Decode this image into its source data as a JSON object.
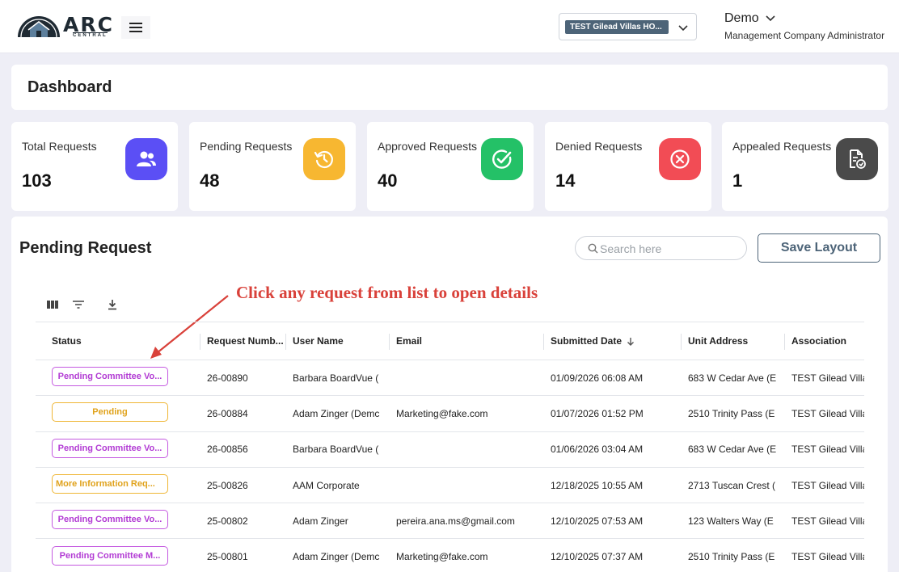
{
  "header": {
    "logo_text": "ARC",
    "logo_subtext": "CENTRAL",
    "association_selected": "TEST Gilead Villas HO...",
    "user_name": "Demo",
    "user_role": "Management Company Administrator"
  },
  "page": {
    "title": "Dashboard"
  },
  "stats": [
    {
      "label": "Total Requests",
      "value": "103",
      "icon": "users-icon",
      "color": "#5b4ff5"
    },
    {
      "label": "Pending Requests",
      "value": "48",
      "icon": "history-icon",
      "color": "#f7b731"
    },
    {
      "label": "Approved Requests",
      "value": "40",
      "icon": "check-circle-icon",
      "color": "#24c167"
    },
    {
      "label": "Denied Requests",
      "value": "14",
      "icon": "x-circle-icon",
      "color": "#f24c55"
    },
    {
      "label": "Appealed Requests",
      "value": "1",
      "icon": "document-refresh-icon",
      "color": "#4a4a4a"
    }
  ],
  "table_section": {
    "title": "Pending Request",
    "search_placeholder": "Search here",
    "save_layout_label": "Save Layout",
    "annotation": "Click any request from list to open details",
    "columns": [
      "Status",
      "Request Numb...",
      "User Name",
      "Email",
      "Submitted Date",
      "Unit Address",
      "Association"
    ],
    "rows": [
      {
        "status": "Pending Committee Vo...",
        "status_type": "committee",
        "request_number": "26-00890",
        "user_name": "Barbara BoardVue (",
        "email": "",
        "submitted_date": "01/09/2026 06:08 AM",
        "unit_address": "683 W Cedar Ave (E",
        "association": "TEST Gilead Villa"
      },
      {
        "status": "Pending",
        "status_type": "pending",
        "request_number": "26-00884",
        "user_name": "Adam Zinger (Demc",
        "email": "Marketing@fake.com",
        "submitted_date": "01/07/2026 01:52 PM",
        "unit_address": "2510 Trinity Pass (E",
        "association": "TEST Gilead Villa"
      },
      {
        "status": "Pending Committee Vo...",
        "status_type": "committee",
        "request_number": "26-00856",
        "user_name": "Barbara BoardVue (",
        "email": "",
        "submitted_date": "01/06/2026 03:04 AM",
        "unit_address": "683 W Cedar Ave (E",
        "association": "TEST Gilead Villa"
      },
      {
        "status": "More Information Req...",
        "status_type": "moreinfo",
        "request_number": "25-00826",
        "user_name": "AAM Corporate",
        "email": "",
        "submitted_date": "12/18/2025 10:55 AM",
        "unit_address": "2713 Tuscan Crest (",
        "association": "TEST Gilead Villa"
      },
      {
        "status": "Pending Committee Vo...",
        "status_type": "committee",
        "request_number": "25-00802",
        "user_name": "Adam Zinger",
        "email": "pereira.ana.ms@gmail.com",
        "submitted_date": "12/10/2025 07:53 AM",
        "unit_address": "123 Walters Way (E",
        "association": "TEST Gilead Villa"
      },
      {
        "status": "Pending Committee M...",
        "status_type": "committee",
        "request_number": "25-00801",
        "user_name": "Adam Zinger (Demc",
        "email": "Marketing@fake.com",
        "submitted_date": "12/10/2025 07:37 AM",
        "unit_address": "2510 Trinity Pass (E",
        "association": "TEST Gilead Villa"
      }
    ]
  }
}
